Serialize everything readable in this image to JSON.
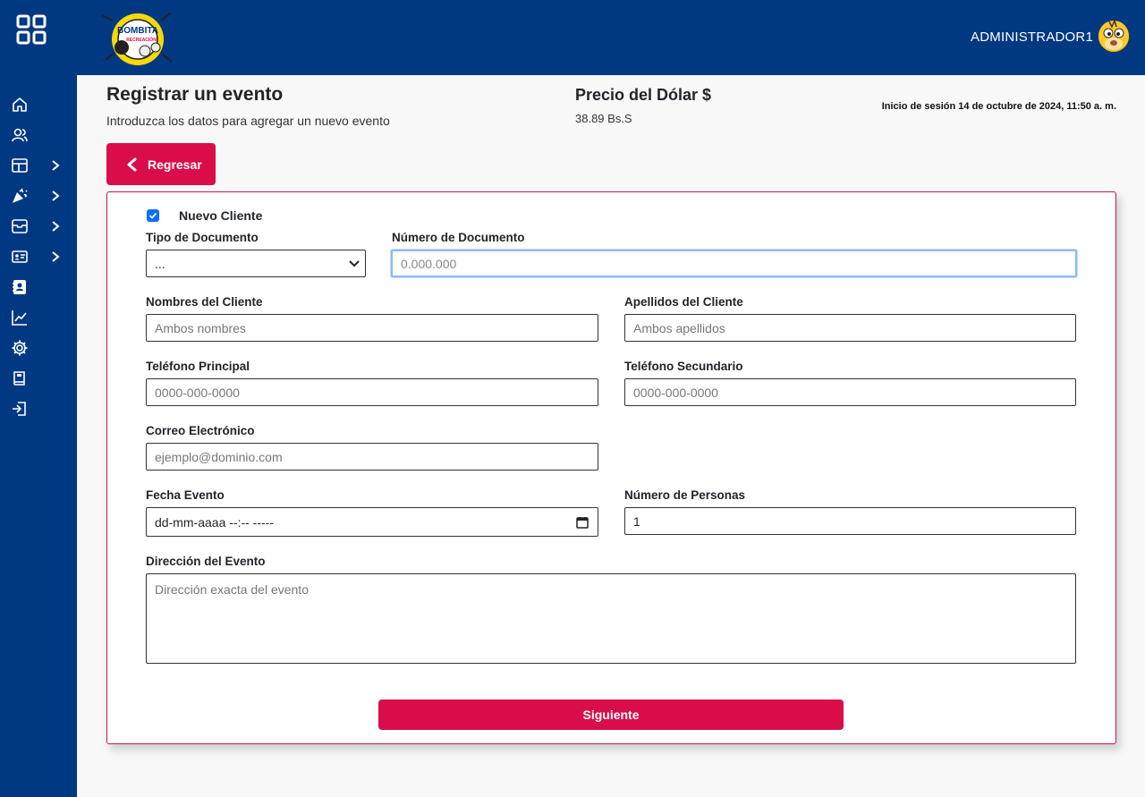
{
  "header": {
    "logo_text": "BOMBITA RECREACIÓN",
    "user_name": "ADMINISTRADOR1"
  },
  "sidebar": {
    "items": [
      {
        "icon": "home-icon",
        "has_submenu": false
      },
      {
        "icon": "users-icon",
        "has_submenu": false
      },
      {
        "icon": "layout-icon",
        "has_submenu": true
      },
      {
        "icon": "party-icon",
        "has_submenu": true
      },
      {
        "icon": "archive-icon",
        "has_submenu": true
      },
      {
        "icon": "id-card-icon",
        "has_submenu": true
      },
      {
        "icon": "contacts-icon",
        "has_submenu": false
      },
      {
        "icon": "chart-icon",
        "has_submenu": false
      },
      {
        "icon": "gear-icon",
        "has_submenu": false
      },
      {
        "icon": "book-icon",
        "has_submenu": false
      },
      {
        "icon": "logout-icon",
        "has_submenu": false
      }
    ]
  },
  "page": {
    "title": "Registrar un evento",
    "subtitle": "Introduzca los datos para agregar un nuevo evento",
    "dollar_title": "Precio del Dólar $",
    "dollar_value": "38.89 Bs.S",
    "session_text": "Inicio de sesión 14 de octubre de 2024, 11:50 a. m.",
    "back_label": "Regresar"
  },
  "form": {
    "new_client_label": "Nuevo Cliente",
    "new_client_checked": true,
    "doc_type_label": "Tipo de Documento",
    "doc_type_value": "...",
    "doc_number_label": "Número de Documento",
    "doc_number_placeholder": "0.000.000",
    "names_label": "Nombres del Cliente",
    "names_placeholder": "Ambos nombres",
    "surnames_label": "Apellidos del Cliente",
    "surnames_placeholder": "Ambos apellidos",
    "phone_main_label": "Teléfono Principal",
    "phone_main_placeholder": "0000-000-0000",
    "phone_sec_label": "Teléfono Secundario",
    "phone_sec_placeholder": "0000-000-0000",
    "email_label": "Correo Electrónico",
    "email_placeholder": "ejemplo@dominio.com",
    "date_label": "Fecha Evento",
    "date_placeholder": "dd-mm-aaaa --:--  -----",
    "people_label": "Número de Personas",
    "people_value": "1",
    "address_label": "Dirección del Evento",
    "address_placeholder": "Dirección exacta del evento",
    "next_label": "Siguiente"
  },
  "colors": {
    "primary": "#003882",
    "accent": "#d90d4a",
    "checkbox": "#0d6efd"
  }
}
